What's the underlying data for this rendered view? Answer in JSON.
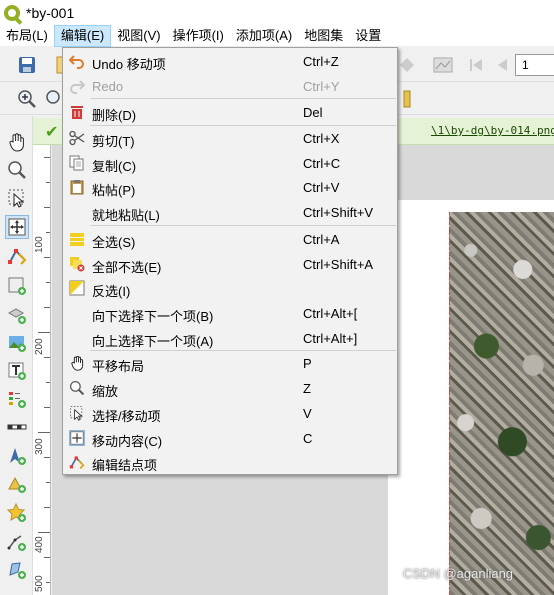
{
  "window": {
    "title": "*by-001"
  },
  "menubar": {
    "items": [
      "布局(L)",
      "编辑(E)",
      "视图(V)",
      "操作项(I)",
      "添加项(A)",
      "地图集",
      "设置"
    ]
  },
  "toolbar": {
    "page_value": "1"
  },
  "banner": {
    "message": "\\1\\by-dg\\by-014.png"
  },
  "ruler": {
    "labels": [
      "100",
      "200",
      "300",
      "400",
      "500"
    ]
  },
  "edit_menu": {
    "items": [
      {
        "label": "Undo 移动项",
        "shortcut": "Ctrl+Z",
        "icon": "undo-icon",
        "enabled": true
      },
      {
        "label": "Redo",
        "shortcut": "Ctrl+Y",
        "icon": "redo-icon",
        "enabled": false
      },
      {
        "label": "删除(D)",
        "shortcut": "Del",
        "icon": "trash-icon",
        "enabled": true
      },
      {
        "label": "剪切(T)",
        "shortcut": "Ctrl+X",
        "icon": "scissors-icon",
        "enabled": true
      },
      {
        "label": "复制(C)",
        "shortcut": "Ctrl+C",
        "icon": "copy-icon",
        "enabled": true
      },
      {
        "label": "粘帖(P)",
        "shortcut": "Ctrl+V",
        "icon": "paste-icon",
        "enabled": true
      },
      {
        "label": "就地粘贴(L)",
        "shortcut": "Ctrl+Shift+V",
        "icon": "",
        "enabled": true
      },
      {
        "label": "全选(S)",
        "shortcut": "Ctrl+A",
        "icon": "select-all-icon",
        "enabled": true
      },
      {
        "label": "全部不选(E)",
        "shortcut": "Ctrl+Shift+A",
        "icon": "deselect-all-icon",
        "enabled": true
      },
      {
        "label": "反选(I)",
        "shortcut": "",
        "icon": "invert-selection-icon",
        "enabled": true
      },
      {
        "label": "向下选择下一个项(B)",
        "shortcut": "Ctrl+Alt+[",
        "icon": "",
        "enabled": true
      },
      {
        "label": "向上选择下一个项(A)",
        "shortcut": "Ctrl+Alt+]",
        "icon": "",
        "enabled": true
      },
      {
        "label": "平移布局",
        "shortcut": "P",
        "icon": "pan-hand-icon",
        "enabled": true
      },
      {
        "label": "缩放",
        "shortcut": "Z",
        "icon": "zoom-icon",
        "enabled": true
      },
      {
        "label": "选择/移动项",
        "shortcut": "V",
        "icon": "select-move-icon",
        "enabled": true
      },
      {
        "label": "移动内容(C)",
        "shortcut": "C",
        "icon": "move-content-icon",
        "enabled": true
      },
      {
        "label": "编辑结点项",
        "shortcut": "",
        "icon": "edit-nodes-icon",
        "enabled": true
      }
    ]
  },
  "watermark": "CSDN @aganliang"
}
